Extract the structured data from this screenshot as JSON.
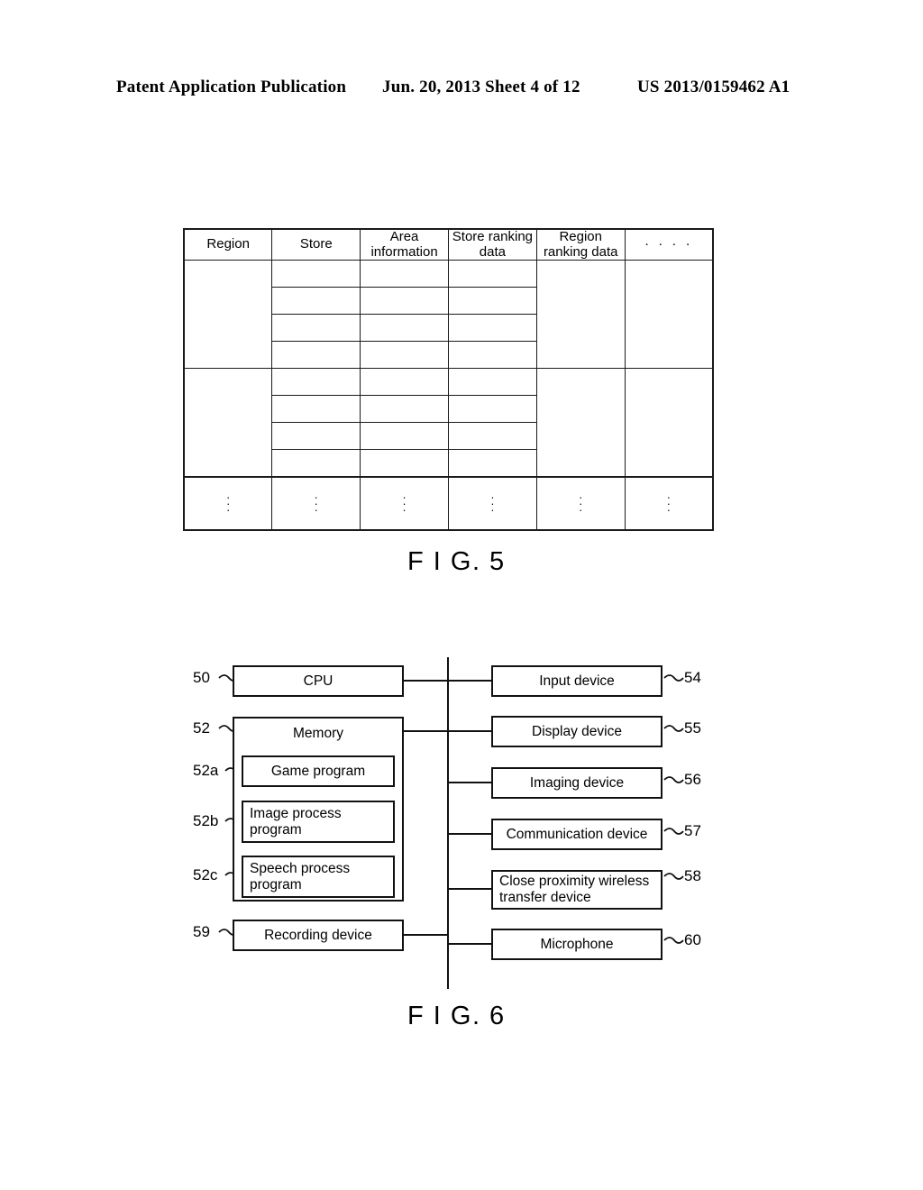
{
  "header": {
    "left": "Patent Application Publication",
    "middle": "Jun. 20, 2013  Sheet 4 of 12",
    "right": "US 2013/0159462 A1"
  },
  "fig5": {
    "label": "F I G. 5",
    "columns": [
      "Region",
      "Store",
      "Area information",
      "Store ranking data",
      "Region ranking data",
      "· · · ·"
    ],
    "vertical_ellipsis": "⋮",
    "row_groups": 2,
    "rows_per_group": 4,
    "cells_empty": ""
  },
  "fig6": {
    "label": "F I G. 6",
    "left_blocks": [
      {
        "ref": "50",
        "label": "CPU"
      },
      {
        "ref": "52",
        "label": "Memory"
      },
      {
        "ref": "52a",
        "label": "Game program"
      },
      {
        "ref": "52b",
        "label": "Image process program"
      },
      {
        "ref": "52c",
        "label": "Speech process program"
      },
      {
        "ref": "59",
        "label": "Recording device"
      }
    ],
    "right_blocks": [
      {
        "ref": "54",
        "label": "Input device"
      },
      {
        "ref": "55",
        "label": "Display device"
      },
      {
        "ref": "56",
        "label": "Imaging device"
      },
      {
        "ref": "57",
        "label": "Communication device"
      },
      {
        "ref": "58",
        "label": "Close proximity wireless transfer device"
      },
      {
        "ref": "60",
        "label": "Microphone"
      }
    ]
  },
  "colors": {
    "ink": "#111111",
    "paper": "#ffffff"
  }
}
